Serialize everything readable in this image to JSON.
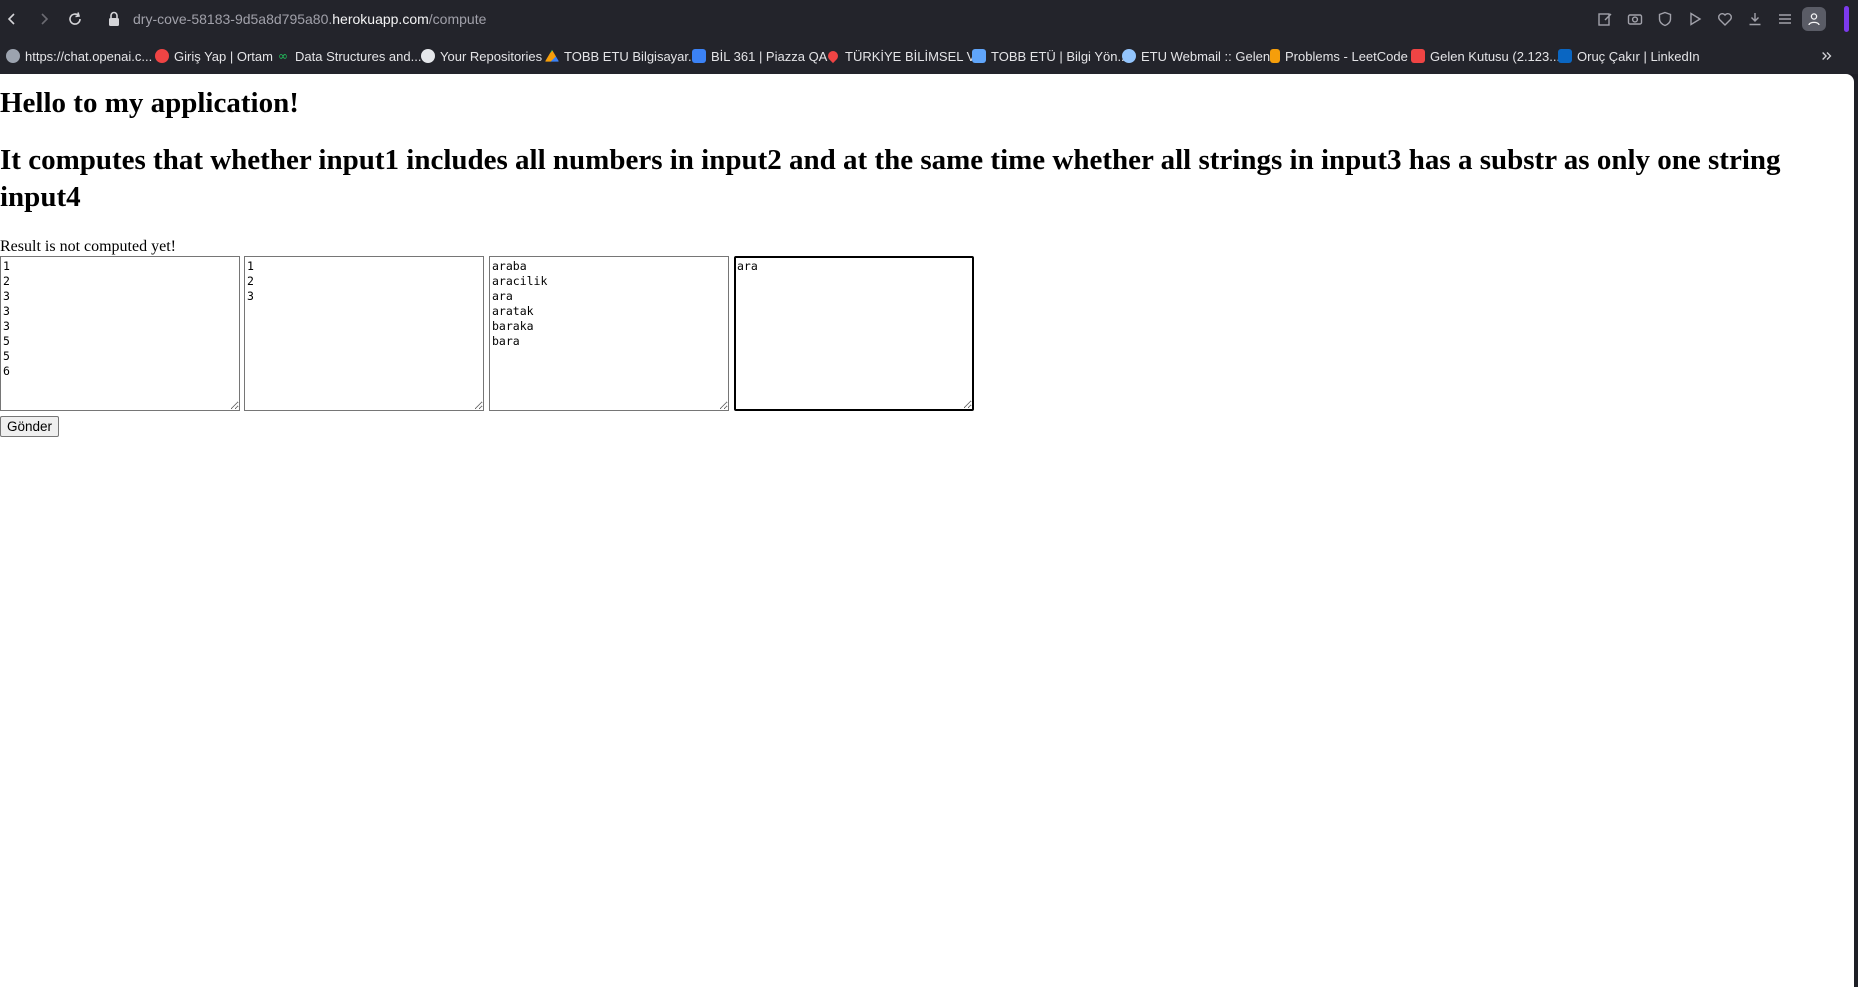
{
  "browser": {
    "url_prefix": "dry-cove-58183-9d5a8d795a80.",
    "url_host": "herokuapp.com",
    "url_path": "/compute",
    "bookmarks": [
      {
        "label": "https://chat.openai.c...",
        "icon": "openai-icon",
        "color": "#9ca3af"
      },
      {
        "label": "Giriş Yap | Ortam",
        "icon": "ortam-icon",
        "color": "#ef4444"
      },
      {
        "label": "Data Structures and...",
        "icon": "infinity-icon",
        "color": "#22c55e"
      },
      {
        "label": "Your Repositories",
        "icon": "github-icon",
        "color": "#e5e7eb"
      },
      {
        "label": "TOBB ETU Bilgisayar...",
        "icon": "google-drive-icon",
        "color": "#f59e0b"
      },
      {
        "label": "BİL 361 | Piazza QA",
        "icon": "piazza-icon",
        "color": "#3b82f6"
      },
      {
        "label": "TÜRKİYE BİLİMSEL V...",
        "icon": "location-pin-icon",
        "color": "#ef4444"
      },
      {
        "label": "TOBB ETÜ | Bilgi Yön...",
        "icon": "tobb-icon",
        "color": "#60a5fa"
      },
      {
        "label": "ETU Webmail :: Gelen",
        "icon": "webmail-icon",
        "color": "#93c5fd"
      },
      {
        "label": "Problems - LeetCode",
        "icon": "leetcode-icon",
        "color": "#f59e0b"
      },
      {
        "label": "Gelen Kutusu (2.123...",
        "icon": "gmail-icon",
        "color": "#ef4444"
      },
      {
        "label": "Oruç Çakır | LinkedIn",
        "icon": "linkedin-icon",
        "color": "#0a66c2"
      }
    ]
  },
  "page": {
    "heading": "Hello to my application!",
    "subheading": "It computes that whether input1 includes all numbers in input2 and at the same time whether all strings in input3 has a substr as only one string input4",
    "result_text": "Result is not computed yet!",
    "inputs": {
      "input1": "1\n2\n3\n3\n3\n5\n5\n6",
      "input2": "1\n2\n3",
      "input3": "araba\naracilik\nara\naratak\nbaraka\nbara",
      "input4": "ara"
    },
    "submit_label": "Gönder"
  }
}
